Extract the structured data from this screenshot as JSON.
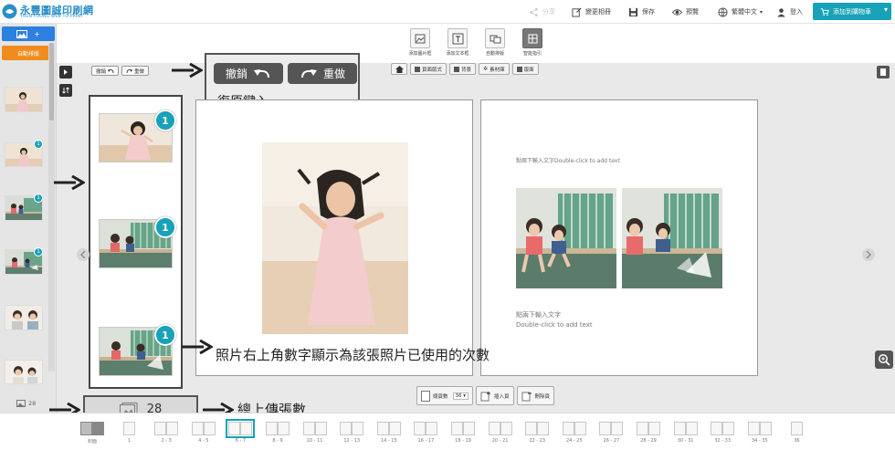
{
  "header": {
    "logo_cn": "永豐圖誠印刷網",
    "logo_en": "YUEN FOONG WEB TO PRINT",
    "share_label": "分享",
    "edit_book_label": "變更相冊",
    "save_label": "保存",
    "preview_label": "預覽",
    "language_label": "繁體中文",
    "login_label": "登入",
    "add_cart_label": "添加到購物車"
  },
  "left_panel": {
    "add_photo_label": "+",
    "auto_layout_label": "自動排版",
    "photo_count": "28",
    "thumb_badges": [
      "",
      "1",
      "1",
      "1",
      "",
      ""
    ]
  },
  "toolbar": {
    "tools": [
      "添加圖片框",
      "添加文本框",
      "自動排版",
      "智能指引"
    ]
  },
  "canvas": {
    "undo_small": "撤銷",
    "redo_small": "重做",
    "tabs": [
      "頁面版式",
      "背景",
      "素材庫",
      "版面"
    ],
    "text_placeholder_top": "點兩下輸入文字Double-click to add text",
    "text_placeholder_bottom_1": "點兩下輸入文字",
    "text_placeholder_bottom_2": "Double-click to add text"
  },
  "callout": {
    "undo_label": "撤銷",
    "redo_label": "重做",
    "caption": "復原鍵入"
  },
  "annotations": {
    "usage_note": "照片右上角數字顯示為該張照片已使用的次數",
    "total_upload_note": "總上傳張數"
  },
  "photo_strip": {
    "badges": [
      "1",
      "1",
      "1"
    ]
  },
  "page_controls": {
    "page_count_label": "總頁數",
    "page_count_value": "36",
    "insert_label": "插入頁",
    "delete_label": "刪除頁"
  },
  "upload_total": "28",
  "filmstrip": {
    "labels": [
      "封面",
      "1",
      "2 - 3",
      "4 - 5",
      "6 - 7",
      "8 - 9",
      "10 - 11",
      "12 - 13",
      "14 - 15",
      "16 - 17",
      "18 - 19",
      "20 - 21",
      "22 - 23",
      "24 - 25",
      "26 - 27",
      "28 - 29",
      "30 - 31",
      "32 - 33",
      "34 - 35",
      "36"
    ],
    "active_index": 4
  },
  "colors": {
    "accent": "#17a2b8",
    "primary_blue": "#2d7fe0",
    "orange": "#f08c1e"
  }
}
